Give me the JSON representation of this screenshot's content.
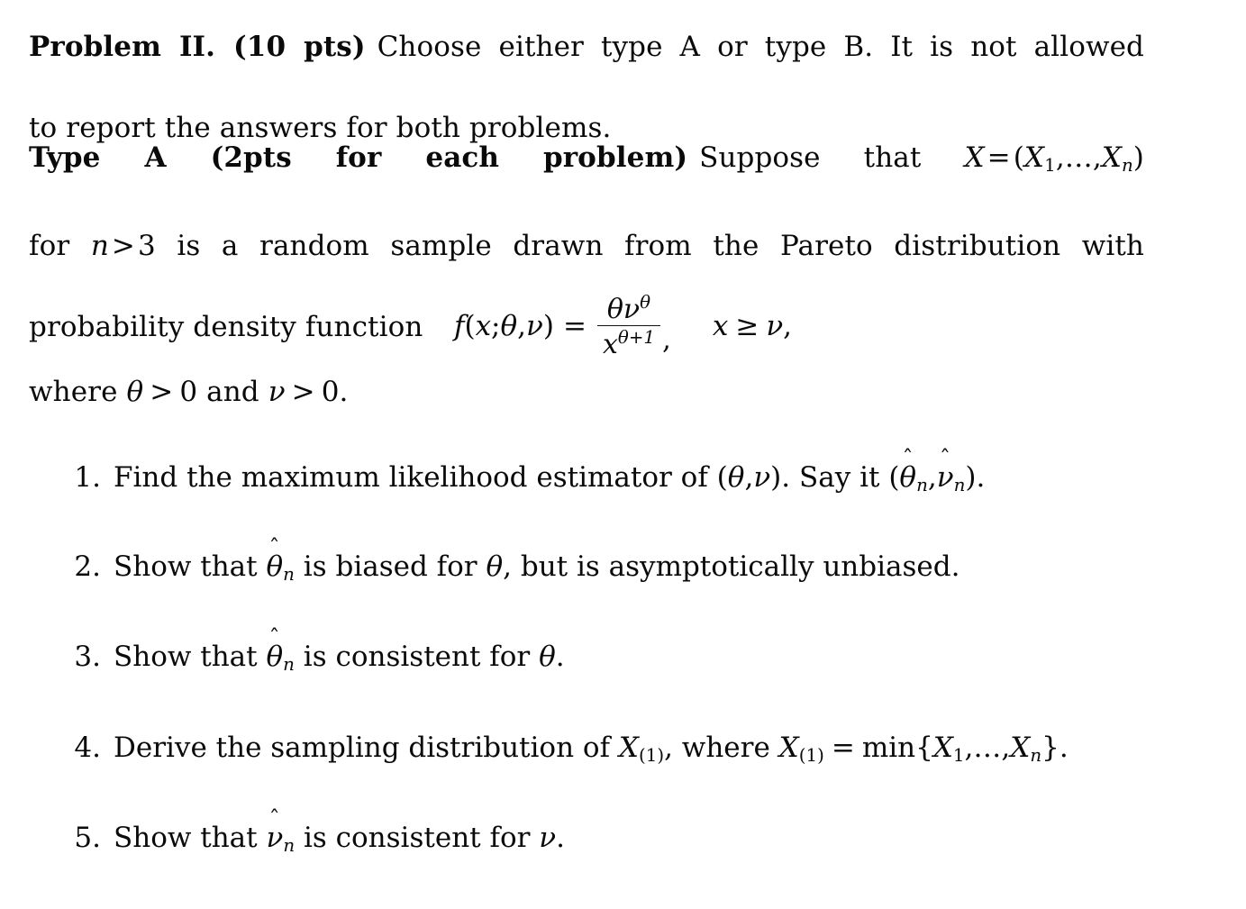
{
  "document": {
    "background_color": "#ffffff",
    "text_color": "#0a0a0a"
  },
  "intro": {
    "heading": "Problem II. (10 pts)",
    "line1_rest": "Choose either type A or type B. It is not allowed",
    "line2": "to report the answers for both problems."
  },
  "typeA": {
    "heading": "Type A (2pts for each problem)",
    "line1_rest_a": "Suppose that",
    "X": "X",
    "eq": "=",
    "tuple_open": "(",
    "X1": "X",
    "sub1": "1",
    "comma_dots": ",…,",
    "Xn": "X",
    "subn": "n",
    "tuple_close": ")",
    "line2_a": "for",
    "n": "n",
    "gt": ">",
    "three": "3",
    "line2_b": "is a random sample drawn from the Pareto distribution with",
    "line3": "probability density function"
  },
  "equation": {
    "f": "f",
    "open": "(",
    "x": "x",
    "semi": ";",
    "theta": "θ",
    "comma": ",",
    "nu": "ν",
    "close": ")",
    "equals": "=",
    "numerator_theta": "θ",
    "numerator_nu": "ν",
    "numerator_exp": "θ",
    "denominator_x": "x",
    "denominator_exp": "θ+1",
    "trailing_comma": ",",
    "condition_x": "x",
    "condition_ge": "≥",
    "condition_nu": "ν",
    "condition_comma": ","
  },
  "where": {
    "prefix": "where",
    "theta": "θ",
    "gt1": ">",
    "zero1": "0",
    "and": "and",
    "nu": "ν",
    "gt2": ">",
    "zero2": "0",
    "period": "."
  },
  "items": [
    {
      "number": "1.",
      "text_a": "Find the maximum likelihood estimator of",
      "open": "(",
      "theta": "θ",
      "comma": ",",
      "nu": "ν",
      "close": ")",
      "text_b": ". Say it",
      "open2": "(",
      "hat_theta": "θ",
      "hat_theta_sub": "n",
      "comma2": ",",
      "hat_nu": "ν",
      "hat_nu_sub": "n",
      "close2": ")",
      "period": ".",
      "hat_mark": "ˆ"
    },
    {
      "number": "2.",
      "text_a": "Show that",
      "hat_theta": "θ",
      "hat_theta_sub": "n",
      "text_b": "is biased for",
      "theta": "θ",
      "text_c": ", but is asymptotically unbiased."
    },
    {
      "number": "3.",
      "text_a": "Show that",
      "hat_theta": "θ",
      "hat_theta_sub": "n",
      "text_b": "is consistent for",
      "theta": "θ",
      "period": "."
    },
    {
      "number": "4.",
      "text_a": "Derive the sampling distribution of",
      "X1": "X",
      "sub1": "(1)",
      "text_b": ", where",
      "X2": "X",
      "sub2": "(1)",
      "equals": "=",
      "min": "min",
      "brace_open": "{",
      "Xa": "X",
      "suba": "1",
      "dots": ",…,",
      "Xb": "X",
      "subb": "n",
      "brace_close": "}",
      "period": "."
    },
    {
      "number": "5.",
      "text_a": "Show that",
      "hat_nu": "ν",
      "hat_nu_sub": "n",
      "text_b": "is consistent for",
      "nu": "ν",
      "period": "."
    }
  ],
  "hat_symbol": "ˆ"
}
